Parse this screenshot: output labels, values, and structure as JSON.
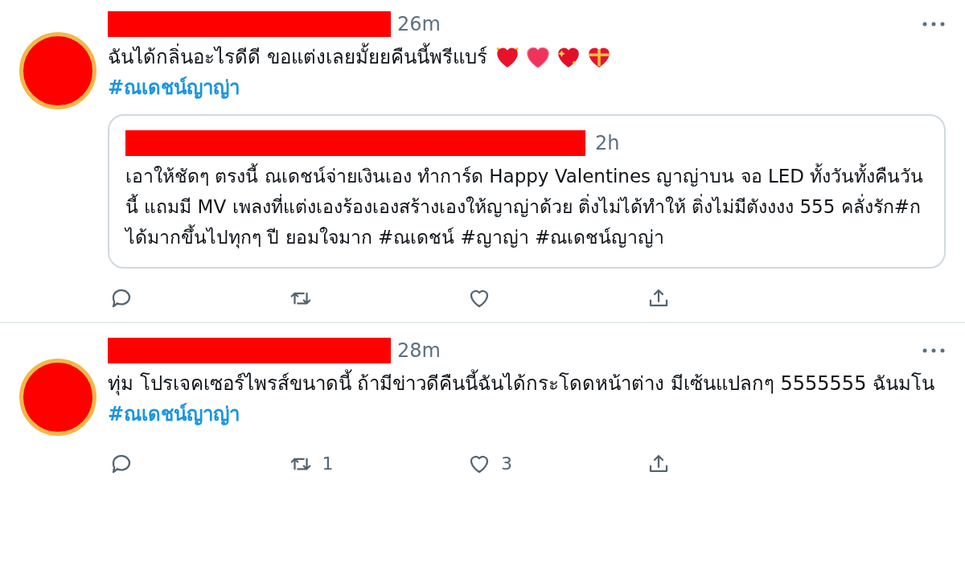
{
  "tweets": [
    {
      "time": "26m",
      "text": "ฉันได้กลิ่นอะไรดีดี ขอแต่งเลยมั้ยยคืนนี้พรีแบร์",
      "emojis": [
        {
          "kind": "horned-heart"
        },
        {
          "kind": "glowing-heart"
        },
        {
          "kind": "sparkle-heart"
        },
        {
          "kind": "gift-heart"
        }
      ],
      "hashtag": "#ณเดชน์ญาญ่า",
      "quote": {
        "time": "2h",
        "text": "เอาให้ชัดๆ ตรงนี้ ณเดชน์จ่ายเงินเอง ทำการ์ด Happy Valentines ญาญ่าบน จอ LED ทั้งวันทั้งคืนวันนี้ แถมมี MV เพลงที่แต่งเองร้องเองสร้างเองให้ญาญ่าด้วย ติ่งไม่ได้ทำให้ ติ่งไม่มีตังงงง 555 คลั่งรัก#กได้มากขึ้นไปทุกๆ ปี ยอมใจมาก #ณเดชน์ #ญาญ่า #ณเดชน์ญาญ่า"
      },
      "actions": [
        {
          "kind": "reply"
        },
        {
          "kind": "retweet"
        },
        {
          "kind": "like"
        },
        {
          "kind": "share"
        }
      ]
    },
    {
      "time": "28m",
      "text": "ทุ่ม โปรเจคเซอร์ไพรส์ขนาดนี้ ถ้ามีข่าวดีคืนนี้ฉันได้กระโดดหน้าต่าง มีเซ้นแปลกๆ 5555555 ฉันมโน",
      "hashtag": "#ณเดชน์ญาญ่า",
      "actions": [
        {
          "kind": "reply"
        },
        {
          "kind": "retweet",
          "count": "1"
        },
        {
          "kind": "like",
          "count": "3"
        },
        {
          "kind": "share"
        }
      ]
    }
  ]
}
